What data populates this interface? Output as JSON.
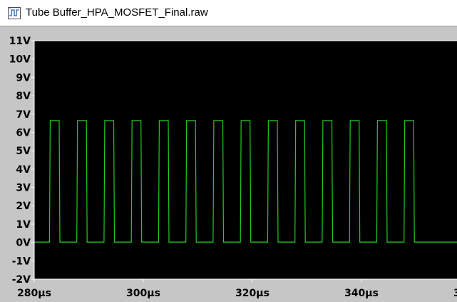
{
  "window": {
    "title": "Tube Buffer_HPA_MOSFET_Final.raw",
    "icon": "waveform-file-icon"
  },
  "chart_data": {
    "type": "line",
    "title": "",
    "xlabel": "",
    "ylabel": "",
    "x_range": [
      280,
      350
    ],
    "x_unit": "µs",
    "ylim": [
      -2,
      11
    ],
    "y_unit": "V",
    "grid": false,
    "y_ticks": [
      "11V",
      "10V",
      "9V",
      "8V",
      "7V",
      "6V",
      "5V",
      "4V",
      "3V",
      "2V",
      "1V",
      "0V",
      "-1V",
      "-2V"
    ],
    "x_ticks": [
      "280µs",
      "300µs",
      "320µs",
      "340µs",
      "3"
    ],
    "colors": {
      "background": "#000000",
      "trace": "#22cc22",
      "frame": "#ffffff"
    },
    "series": [
      {
        "signal": "square_wave",
        "period_us": 5.0,
        "high_level_v": 6.65,
        "low_level_v": 0.02,
        "high_intervals_us": [
          [
            282.8,
            284.7
          ],
          [
            287.8,
            289.7
          ],
          [
            292.8,
            294.7
          ],
          [
            297.8,
            299.7
          ],
          [
            302.8,
            304.7
          ],
          [
            307.8,
            309.7
          ],
          [
            312.8,
            314.7
          ],
          [
            317.8,
            319.7
          ],
          [
            322.8,
            324.7
          ],
          [
            327.8,
            329.7
          ],
          [
            332.8,
            334.7
          ],
          [
            337.8,
            339.7
          ],
          [
            342.8,
            344.7
          ],
          [
            347.8,
            349.7
          ]
        ]
      }
    ]
  }
}
